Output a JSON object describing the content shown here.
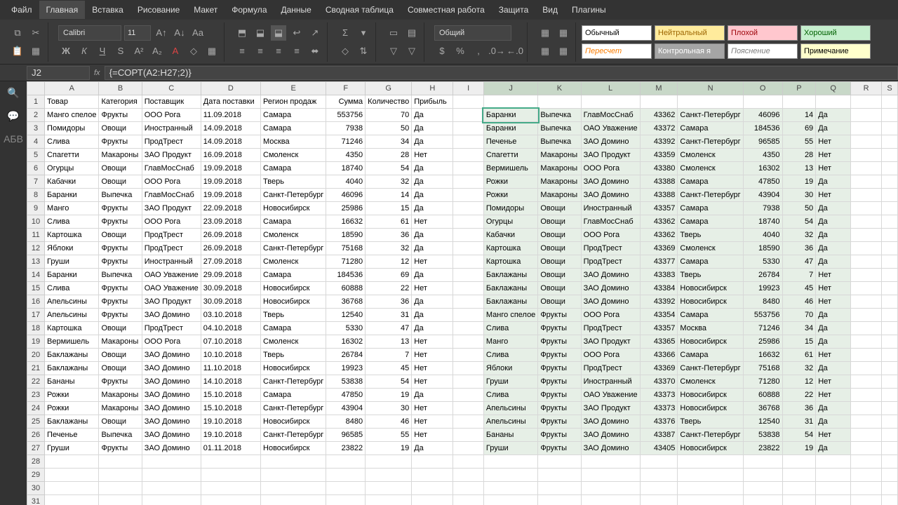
{
  "menu": {
    "items": [
      "Файл",
      "Главная",
      "Вставка",
      "Рисование",
      "Макет",
      "Формула",
      "Данные",
      "Сводная таблица",
      "Совместная работа",
      "Защита",
      "Вид",
      "Плагины"
    ],
    "active": 1
  },
  "toolbar": {
    "font": "Calibri",
    "size": "11",
    "numfmt": "Общий",
    "styles": [
      {
        "label": "Обычный",
        "bg": "#fff",
        "fg": "#000"
      },
      {
        "label": "Нейтральный",
        "bg": "#ffeb9c",
        "fg": "#9c6500"
      },
      {
        "label": "Плохой",
        "bg": "#ffc7ce",
        "fg": "#9c0006"
      },
      {
        "label": "Хороший",
        "bg": "#c6efce",
        "fg": "#006100"
      },
      {
        "label": "Пересчет",
        "bg": "#fff",
        "fg": "#fa7d00",
        "it": true
      },
      {
        "label": "Контрольная я",
        "bg": "#a5a5a5",
        "fg": "#fff"
      },
      {
        "label": "Пояснение",
        "bg": "#fff",
        "fg": "#7f7f7f",
        "it": true
      },
      {
        "label": "Примечание",
        "bg": "#ffffcc",
        "fg": "#000"
      }
    ]
  },
  "formula": {
    "cell": "J2",
    "value": "{=СОРТ(A2:H27;2)}"
  },
  "cols": [
    "A",
    "B",
    "C",
    "D",
    "E",
    "F",
    "G",
    "H",
    "I",
    "J",
    "K",
    "L",
    "M",
    "N",
    "O",
    "P",
    "Q",
    "R",
    "S"
  ],
  "headers": [
    "Товар",
    "Категория",
    "Поставщик",
    "Дата поставки",
    "Регион продаж",
    "Сумма",
    "Количество",
    "Прибыль"
  ],
  "left": [
    [
      "Манго спелое",
      "Фрукты",
      "ООО Рога",
      "11.09.2018",
      "Самара",
      553756,
      70,
      "Да"
    ],
    [
      "Помидоры",
      "Овощи",
      "Иностранный",
      "14.09.2018",
      "Самара",
      7938,
      50,
      "Да"
    ],
    [
      "Слива",
      "Фрукты",
      "ПродТрест",
      "14.09.2018",
      "Москва",
      71246,
      34,
      "Да"
    ],
    [
      "Спагетти",
      "Макароны",
      "ЗАО Продукт",
      "16.09.2018",
      "Смоленск",
      4350,
      28,
      "Нет"
    ],
    [
      "Огурцы",
      "Овощи",
      "ГлавМосСнаб",
      "19.09.2018",
      "Самара",
      18740,
      54,
      "Да"
    ],
    [
      "Кабачки",
      "Овощи",
      "ООО Рога",
      "19.09.2018",
      "Тверь",
      4040,
      32,
      "Да"
    ],
    [
      "Баранки",
      "Выпечка",
      "ГлавМосСнаб",
      "19.09.2018",
      "Санкт-Петербург",
      46096,
      14,
      "Да"
    ],
    [
      "Манго",
      "Фрукты",
      "ЗАО Продукт",
      "22.09.2018",
      "Новосибирск",
      25986,
      15,
      "Да"
    ],
    [
      "Слива",
      "Фрукты",
      "ООО Рога",
      "23.09.2018",
      "Самара",
      16632,
      61,
      "Нет"
    ],
    [
      "Картошка",
      "Овощи",
      "ПродТрест",
      "26.09.2018",
      "Смоленск",
      18590,
      36,
      "Да"
    ],
    [
      "Яблоки",
      "Фрукты",
      "ПродТрест",
      "26.09.2018",
      "Санкт-Петербург",
      75168,
      32,
      "Да"
    ],
    [
      "Груши",
      "Фрукты",
      "Иностранный",
      "27.09.2018",
      "Смоленск",
      71280,
      12,
      "Нет"
    ],
    [
      "Баранки",
      "Выпечка",
      "ОАО Уважение",
      "29.09.2018",
      "Самара",
      184536,
      69,
      "Да"
    ],
    [
      "Слива",
      "Фрукты",
      "ОАО Уважение",
      "30.09.2018",
      "Новосибирск",
      60888,
      22,
      "Нет"
    ],
    [
      "Апельсины",
      "Фрукты",
      "ЗАО Продукт",
      "30.09.2018",
      "Новосибирск",
      36768,
      36,
      "Да"
    ],
    [
      "Апельсины",
      "Фрукты",
      "ЗАО Домино",
      "03.10.2018",
      "Тверь",
      12540,
      31,
      "Да"
    ],
    [
      "Картошка",
      "Овощи",
      "ПродТрест",
      "04.10.2018",
      "Самара",
      5330,
      47,
      "Да"
    ],
    [
      "Вермишель",
      "Макароны",
      "ООО Рога",
      "07.10.2018",
      "Смоленск",
      16302,
      13,
      "Нет"
    ],
    [
      "Баклажаны",
      "Овощи",
      "ЗАО Домино",
      "10.10.2018",
      "Тверь",
      26784,
      7,
      "Нет"
    ],
    [
      "Баклажаны",
      "Овощи",
      "ЗАО Домино",
      "11.10.2018",
      "Новосибирск",
      19923,
      45,
      "Нет"
    ],
    [
      "Бананы",
      "Фрукты",
      "ЗАО Домино",
      "14.10.2018",
      "Санкт-Петербург",
      53838,
      54,
      "Нет"
    ],
    [
      "Рожки",
      "Макароны",
      "ЗАО Домино",
      "15.10.2018",
      "Самара",
      47850,
      19,
      "Да"
    ],
    [
      "Рожки",
      "Макароны",
      "ЗАО Домино",
      "15.10.2018",
      "Санкт-Петербург",
      43904,
      30,
      "Нет"
    ],
    [
      "Баклажаны",
      "Овощи",
      "ЗАО Домино",
      "19.10.2018",
      "Новосибирск",
      8480,
      46,
      "Нет"
    ],
    [
      "Печенье",
      "Выпечка",
      "ЗАО Домино",
      "19.10.2018",
      "Санкт-Петербург",
      96585,
      55,
      "Нет"
    ],
    [
      "Груши",
      "Фрукты",
      "ЗАО Домино",
      "01.11.2018",
      "Новосибирск",
      23822,
      19,
      "Да"
    ]
  ],
  "right": [
    [
      "Баранки",
      "Выпечка",
      "ГлавМосСнаб",
      43362,
      "Санкт-Петербург",
      46096,
      14,
      "Да"
    ],
    [
      "Баранки",
      "Выпечка",
      "ОАО Уважение",
      43372,
      "Самара",
      184536,
      69,
      "Да"
    ],
    [
      "Печенье",
      "Выпечка",
      "ЗАО Домино",
      43392,
      "Санкт-Петербург",
      96585,
      55,
      "Нет"
    ],
    [
      "Спагетти",
      "Макароны",
      "ЗАО Продукт",
      43359,
      "Смоленск",
      4350,
      28,
      "Нет"
    ],
    [
      "Вермишель",
      "Макароны",
      "ООО Рога",
      43380,
      "Смоленск",
      16302,
      13,
      "Нет"
    ],
    [
      "Рожки",
      "Макароны",
      "ЗАО Домино",
      43388,
      "Самара",
      47850,
      19,
      "Да"
    ],
    [
      "Рожки",
      "Макароны",
      "ЗАО Домино",
      43388,
      "Санкт-Петербург",
      43904,
      30,
      "Нет"
    ],
    [
      "Помидоры",
      "Овощи",
      "Иностранный",
      43357,
      "Самара",
      7938,
      50,
      "Да"
    ],
    [
      "Огурцы",
      "Овощи",
      "ГлавМосСнаб",
      43362,
      "Самара",
      18740,
      54,
      "Да"
    ],
    [
      "Кабачки",
      "Овощи",
      "ООО Рога",
      43362,
      "Тверь",
      4040,
      32,
      "Да"
    ],
    [
      "Картошка",
      "Овощи",
      "ПродТрест",
      43369,
      "Смоленск",
      18590,
      36,
      "Да"
    ],
    [
      "Картошка",
      "Овощи",
      "ПродТрест",
      43377,
      "Самара",
      5330,
      47,
      "Да"
    ],
    [
      "Баклажаны",
      "Овощи",
      "ЗАО Домино",
      43383,
      "Тверь",
      26784,
      7,
      "Нет"
    ],
    [
      "Баклажаны",
      "Овощи",
      "ЗАО Домино",
      43384,
      "Новосибирск",
      19923,
      45,
      "Нет"
    ],
    [
      "Баклажаны",
      "Овощи",
      "ЗАО Домино",
      43392,
      "Новосибирск",
      8480,
      46,
      "Нет"
    ],
    [
      "Манго спелое",
      "Фрукты",
      "ООО Рога",
      43354,
      "Самара",
      553756,
      70,
      "Да"
    ],
    [
      "Слива",
      "Фрукты",
      "ПродТрест",
      43357,
      "Москва",
      71246,
      34,
      "Да"
    ],
    [
      "Манго",
      "Фрукты",
      "ЗАО Продукт",
      43365,
      "Новосибирск",
      25986,
      15,
      "Да"
    ],
    [
      "Слива",
      "Фрукты",
      "ООО Рога",
      43366,
      "Самара",
      16632,
      61,
      "Нет"
    ],
    [
      "Яблоки",
      "Фрукты",
      "ПродТрест",
      43369,
      "Санкт-Петербург",
      75168,
      32,
      "Да"
    ],
    [
      "Груши",
      "Фрукты",
      "Иностранный",
      43370,
      "Смоленск",
      71280,
      12,
      "Нет"
    ],
    [
      "Слива",
      "Фрукты",
      "ОАО Уважение",
      43373,
      "Новосибирск",
      60888,
      22,
      "Нет"
    ],
    [
      "Апельсины",
      "Фрукты",
      "ЗАО Продукт",
      43373,
      "Новосибирск",
      36768,
      36,
      "Да"
    ],
    [
      "Апельсины",
      "Фрукты",
      "ЗАО Домино",
      43376,
      "Тверь",
      12540,
      31,
      "Да"
    ],
    [
      "Бананы",
      "Фрукты",
      "ЗАО Домино",
      43387,
      "Санкт-Петербург",
      53838,
      54,
      "Нет"
    ],
    [
      "Груши",
      "Фрукты",
      "ЗАО Домино",
      43405,
      "Новосибирск",
      23822,
      19,
      "Да"
    ]
  ]
}
